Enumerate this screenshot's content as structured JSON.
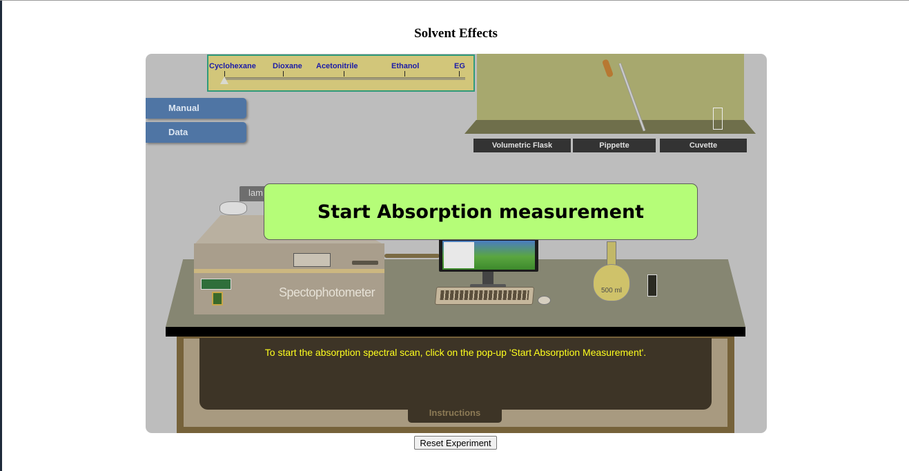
{
  "page": {
    "title": "Solvent Effects"
  },
  "solvents": {
    "labels": [
      "Cyclohexane",
      "Dioxane",
      "Acetonitrile",
      "Ethanol",
      "EG"
    ]
  },
  "menu": {
    "manual_label": "Manual",
    "data_label": "Data"
  },
  "shelf": {
    "volumetric_flask_label": "Volumetric Flask",
    "pipette_label": "Pippette",
    "cuvette_label": "Cuvette"
  },
  "instrument": {
    "lamp_label": "lamp",
    "name_label": "Spectophotometer"
  },
  "flask": {
    "volume_label": "500  ml"
  },
  "popup": {
    "label": "Start Absorption measurement"
  },
  "instructions": {
    "text": "To start the absorption spectral scan, click on the pop-up 'Start Absorption Measurement'.",
    "tab_label": "Instructions"
  },
  "reset": {
    "label": "Reset Experiment"
  },
  "colors": {
    "popup": "#b5fd78",
    "menu": "#4f75a4",
    "instruction_text": "#ffff1e",
    "solvent_label": "#1b1ba8"
  }
}
